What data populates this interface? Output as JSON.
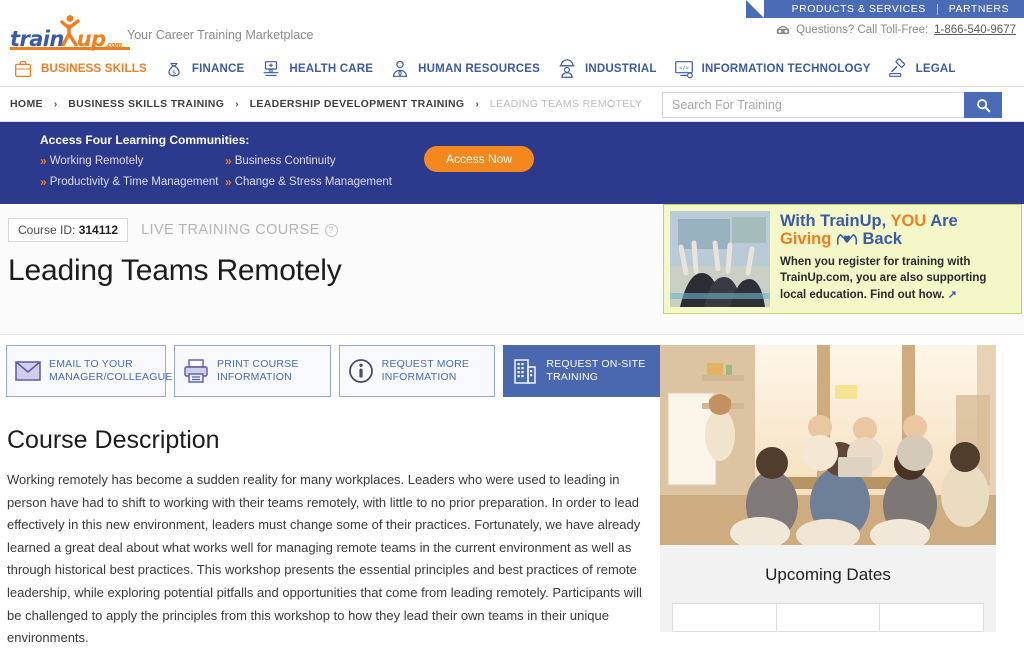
{
  "topbar": {
    "links": [
      "PRODUCTS & SERVICES",
      "PARTNERS"
    ]
  },
  "brand": {
    "logo_train": "train",
    "logo_up": "up",
    "logo_dotcom": ".com",
    "tagline": "Your Career Training Marketplace",
    "phone_label": "Questions? Call Toll-Free:",
    "phone_number": "1-866-540-9677",
    "phone_icon": "telephone-icon"
  },
  "categories": [
    {
      "label": "BUSINESS SKILLS",
      "icon": "briefcase-icon",
      "active": true
    },
    {
      "label": "FINANCE",
      "icon": "money-bag-icon",
      "active": false
    },
    {
      "label": "HEALTH CARE",
      "icon": "medical-icon",
      "active": false
    },
    {
      "label": "HUMAN RESOURCES",
      "icon": "person-tie-icon",
      "active": false
    },
    {
      "label": "INDUSTRIAL",
      "icon": "hardhat-worker-icon",
      "active": false
    },
    {
      "label": "INFORMATION TECHNOLOGY",
      "icon": "code-monitor-icon",
      "active": false
    },
    {
      "label": "LEGAL",
      "icon": "gavel-icon",
      "active": false
    }
  ],
  "breadcrumb": {
    "items": [
      "HOME",
      "BUSINESS SKILLS TRAINING",
      "LEADERSHIP DEVELOPMENT TRAINING",
      "LEADING TEAMS REMOTELY"
    ],
    "separator": "›"
  },
  "search": {
    "placeholder": "Search For Training",
    "value": "",
    "icon": "search-icon"
  },
  "promo": {
    "heading": "Access Four Learning Communities:",
    "items": [
      "Working Remotely",
      "Business Continuity",
      "Productivity & Time Management",
      "Change & Stress Management"
    ],
    "button": "Access Now",
    "bullet_icon": "double-chevron-right-icon"
  },
  "course": {
    "id_label": "Course ID:",
    "id_value": "314112",
    "type_label": "LIVE TRAINING COURSE",
    "help_icon": "question-mark-icon",
    "title": "Leading Teams Remotely"
  },
  "giveback": {
    "headline_1": "With TrainUp, ",
    "headline_you": "YOU",
    "headline_2": " Are",
    "headline_3": "Giving ",
    "headline_4": " Back",
    "body": "When you register for training with TrainUp.com, you are also supporting local education. Find out how.",
    "external_icon": "external-link-icon",
    "hands_heart_icon": "hands-heart-icon",
    "photo_alt": "students-raising-hands-photo"
  },
  "actions": [
    {
      "label_1": "EMAIL TO YOUR",
      "label_2": "MANAGER/COLLEAGUE",
      "icon": "envelope-icon",
      "primary": false
    },
    {
      "label_1": "PRINT COURSE",
      "label_2": "INFORMATION",
      "icon": "printer-icon",
      "primary": false
    },
    {
      "label_1": "REQUEST MORE",
      "label_2": "INFORMATION",
      "icon": "info-circle-icon",
      "primary": false
    },
    {
      "label_1": "REQUEST ON-SITE",
      "label_2": "TRAINING",
      "icon": "office-building-icon",
      "primary": true
    }
  ],
  "description": {
    "heading": "Course Description",
    "body": "Working remotely has become a sudden reality for many workplaces. Leaders who were used to leading in person have had to shift to working with their teams remotely, with little to no prior preparation. In order to lead effectively in this new environment, leaders must change some of their practices. Fortunately, we have already learned a great deal about what works well for managing remote teams in the current environment as well as through historical best practices. This workshop presents the essential principles and best practices of remote leadership, while exploring potential pitfalls and opportunities that come from leading remotely. Participants will be challenged to apply the principles from this workshop to how they lead their own teams in their unique environments."
  },
  "sidebar": {
    "hero_alt": "team-meeting-workshop-photo",
    "dates_title": "Upcoming Dates"
  },
  "colors": {
    "brand_blue": "#3b5ba5",
    "brand_orange": "#f07e20",
    "nav_blue": "#4a6bb5",
    "promo_navy": "#2b3a8c",
    "giveback_yellow": "#f4f8c8"
  }
}
